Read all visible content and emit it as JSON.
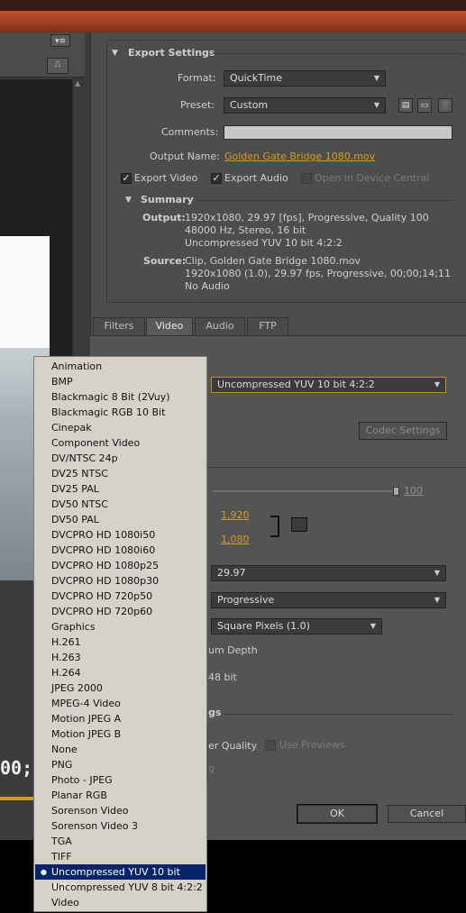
{
  "export_settings": {
    "section_title": "Export Settings",
    "format_label": "Format:",
    "format_value": "QuickTime",
    "preset_label": "Preset:",
    "preset_value": "Custom",
    "comments_label": "Comments:",
    "comments_value": "",
    "output_name_label": "Output Name:",
    "output_name_value": "Golden Gate Bridge 1080.mov",
    "export_video_label": "Export Video",
    "export_audio_label": "Export Audio",
    "open_device_central_label": "Open in Device Central",
    "export_video_checked": true,
    "export_audio_checked": true,
    "open_device_central_checked": false
  },
  "summary": {
    "title": "Summary",
    "output_label": "Output:",
    "output_lines": [
      "1920x1080, 29.97 [fps], Progressive, Quality 100",
      "48000 Hz, Stereo, 16 bit",
      "Uncompressed YUV 10 bit 4:2:2"
    ],
    "source_label": "Source:",
    "source_lines": [
      "Clip, Golden Gate Bridge 1080.mov",
      "1920x1080 (1.0), 29.97 fps, Progressive, 00;00;14;11",
      "No Audio"
    ]
  },
  "tabs": [
    {
      "label": "Filters",
      "active": false
    },
    {
      "label": "Video",
      "active": true
    },
    {
      "label": "Audio",
      "active": false
    },
    {
      "label": "FTP",
      "active": false
    }
  ],
  "video": {
    "codec_value": "Uncompressed YUV 10 bit 4:2:2",
    "codec_settings_label": "Codec Settings",
    "quality_value": "100",
    "width_value": "1,920",
    "height_value": "1,080",
    "frame_rate_value": "29.97",
    "field_type_value": "Progressive",
    "aspect_value": "Square Pixels (1.0)",
    "depth_label_partial": "um Depth",
    "depth_value_partial": "48 bit",
    "settings_partial": "gs",
    "render_quality_partial": "er Quality",
    "use_previews_label": "Use Previews",
    "partial_g": "g"
  },
  "buttons": {
    "ok": "OK",
    "cancel": "Cancel"
  },
  "timecode_partial": "00;1",
  "codec_list": {
    "items": [
      "Animation",
      "BMP",
      "Blackmagic 8 Bit (2Vuy)",
      "Blackmagic RGB 10 Bit",
      "Cinepak",
      "Component Video",
      "DV/NTSC 24p",
      "DV25 NTSC",
      "DV25 PAL",
      "DV50 NTSC",
      "DV50 PAL",
      "DVCPRO HD 1080i50",
      "DVCPRO HD 1080i60",
      "DVCPRO HD 1080p25",
      "DVCPRO HD 1080p30",
      "DVCPRO HD 720p50",
      "DVCPRO HD 720p60",
      "Graphics",
      "H.261",
      "H.263",
      "H.264",
      "JPEG 2000",
      "MPEG-4 Video",
      "Motion JPEG A",
      "Motion JPEG B",
      "None",
      "PNG",
      "Photo - JPEG",
      "Planar RGB",
      "Sorenson Video",
      "Sorenson Video 3",
      "TGA",
      "TIFF",
      "Uncompressed YUV 10 bit 4:2:2",
      "Uncompressed YUV 8 bit 4:2:2",
      "Video"
    ],
    "selected": "Uncompressed YUV 10 bit 4:2:2"
  }
}
